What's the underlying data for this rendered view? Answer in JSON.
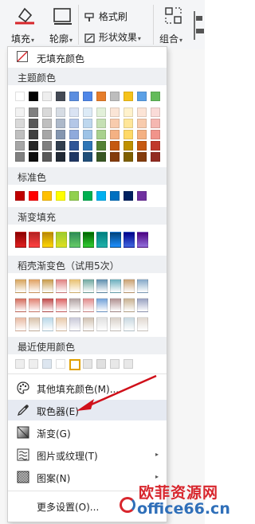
{
  "ribbon": {
    "fill_label": "填充",
    "outline_label": "轮廓",
    "format_brush_label": "格式刷",
    "shape_effect_label": "形状效果",
    "group_label": "组合"
  },
  "menu": {
    "no_fill_label": "无填充颜色",
    "theme_header": "主题颜色",
    "standard_header": "标准色",
    "gradient_header": "渐变填充",
    "docer_header": "稻壳渐变色（试用5次）",
    "recent_header": "最近使用颜色",
    "more_colors_label": "其他填充颜色(M)...",
    "eyedropper_label": "取色器(E)",
    "gradient_label": "渐变(G)",
    "picture_label": "图片或纹理(T)",
    "pattern_label": "图案(N)",
    "more_settings_label": "更多设置(O)..."
  },
  "watermark": {
    "text": "欧菲资源网",
    "url": "office66.cn"
  },
  "colors": {
    "theme_top": [
      "#ffffff",
      "#000000",
      "#eeeeee",
      "#444a55",
      "#5b8ee0",
      "#4e86e8",
      "#e67d2a",
      "#bdbdbd",
      "#f6c31a",
      "#5aa0e6",
      "#63bb5a"
    ],
    "theme_cols": [
      [
        "#f2f2f2",
        "#d9d9d9",
        "#bfbfbf",
        "#a6a6a6",
        "#808080"
      ],
      [
        "#808080",
        "#595959",
        "#404040",
        "#262626",
        "#0d0d0d"
      ],
      [
        "#d9d9d9",
        "#bfbfbf",
        "#a6a6a6",
        "#7f7f7f",
        "#595959"
      ],
      [
        "#d6dce4",
        "#adb9ca",
        "#8496b0",
        "#323f4f",
        "#222a35"
      ],
      [
        "#dae3f3",
        "#b4c7e7",
        "#8faadc",
        "#2f5597",
        "#203864"
      ],
      [
        "#ddebf7",
        "#bdd7ee",
        "#9dc3e6",
        "#2e75b6",
        "#1f4e79"
      ],
      [
        "#e2f0d9",
        "#c5e0b4",
        "#a9d18e",
        "#548235",
        "#385723"
      ],
      [
        "#fbe5d6",
        "#f8cbad",
        "#f4b183",
        "#c55a11",
        "#843c0c"
      ],
      [
        "#fff2cc",
        "#ffe699",
        "#ffd966",
        "#bf9000",
        "#7f6000"
      ],
      [
        "#fce4d6",
        "#f8cbad",
        "#f4b183",
        "#c65911",
        "#843c0c"
      ],
      [
        "#fadbd8",
        "#f5b7b1",
        "#f1948a",
        "#c0392b",
        "#922b21"
      ]
    ],
    "standard": [
      "#c00000",
      "#ff0000",
      "#ffc000",
      "#ffff00",
      "#92d050",
      "#00b050",
      "#00b0f0",
      "#0070c0",
      "#002060",
      "#7030a0"
    ],
    "gradients": [
      [
        "#8b0000",
        "#e02020"
      ],
      [
        "#b22222",
        "#ff4040"
      ],
      [
        "#b8860b",
        "#ffd700"
      ],
      [
        "#9acd32",
        "#e0e020"
      ],
      [
        "#2e8b57",
        "#66cc66"
      ],
      [
        "#006400",
        "#32cd32"
      ],
      [
        "#008080",
        "#20b2aa"
      ],
      [
        "#00427a",
        "#1e90ff"
      ],
      [
        "#00008b",
        "#4169e1"
      ],
      [
        "#4b0082",
        "#9370db"
      ]
    ],
    "docer_row1": [
      "#d7a35a",
      "#e0a060",
      "#c89a48",
      "#e08080",
      "#e8c070",
      "#6fa8a0",
      "#5e8fae",
      "#6aaebd",
      "#c9a070",
      "#84a8c8"
    ],
    "docer_row2": [
      "#d46a5a",
      "#e08070",
      "#c04848",
      "#dc6060",
      "#b0a0a0",
      "#e08a8a",
      "#70a0d8",
      "#b09090",
      "#c8b090",
      "#98a0c0"
    ],
    "docer_row3": [
      "#e8b8a0",
      "#d8c0a8",
      "#b8d8e8",
      "#e8c8a8",
      "#c8c8d8",
      "#d0c0b0",
      "#e0e0e0",
      "#d8d0c8",
      "#c8d8e0",
      "#e0d8d0"
    ],
    "recent": [
      "#eeeeee",
      "#eeeeee",
      "#dde6f0",
      "#ffffff",
      "#ffffff",
      "#e5e5e5",
      "#e0e0e0",
      "#e8e8e8",
      "#e8e8e8"
    ],
    "recent_selected_border": "#e0a000",
    "highlight": "#e6eaf2",
    "watermark_red": "#d8262d",
    "watermark_blue": "#2f6fb9",
    "arrow": "#d0101a"
  }
}
